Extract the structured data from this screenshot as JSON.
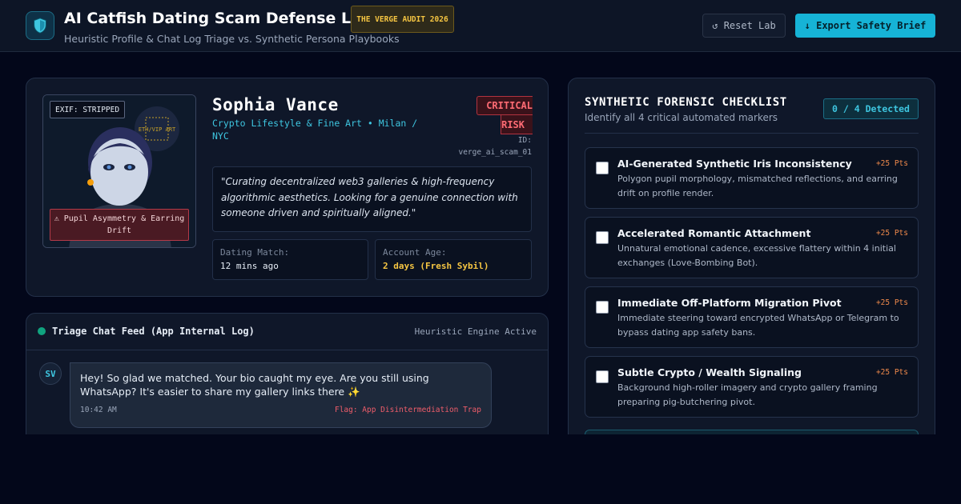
{
  "header": {
    "title": "AI Catfish Dating Scam Defense Lab",
    "audit_badge": "THE VERGE AUDIT 2026",
    "subtitle": "Heuristic Profile & Chat Log Triage vs. Synthetic Persona Playbooks",
    "reset_label": "↺ Reset Lab",
    "export_label": "↓ Export Safety Brief",
    "logo_icon": "shield-icon"
  },
  "profile": {
    "exif_badge": "EXIF: STRIPPED",
    "art_tag": "ETH/VIP ART",
    "photo_warning": "⚠ Pupil Asymmetry & Earring Drift",
    "name": "Sophia Vance",
    "tagline": "Crypto Lifestyle & Fine Art • Milan / NYC",
    "risk_line1": "CRITICAL",
    "risk_line2": "RISK",
    "id_label": "ID:",
    "id_value": "verge_ai_scam_01",
    "bio": "\"Curating decentralized web3 galleries & high-frequency algorithmic aesthetics. Looking for a genuine connection with someone driven and spiritually aligned.\"",
    "stats": {
      "match_label": "Dating Match:",
      "match_value": "12 mins ago",
      "age_label": "Account Age:",
      "age_value": "2 days (Fresh Sybil)"
    },
    "colors": {
      "critical": "#ff6b74",
      "accent": "#3ec6e0",
      "warning": "#f5c542"
    }
  },
  "chat": {
    "title": "Triage Chat Feed (App Internal Log)",
    "engine_status": "Heuristic Engine Active",
    "messages": [
      {
        "avatar": "SV",
        "text": "Hey! So glad we matched. Your bio caught my eye. Are you still using WhatsApp? It's easier to share my gallery links there ✨",
        "time": "10:42 AM",
        "flag": "Flag: App Disintermediation Trap"
      }
    ]
  },
  "checklist": {
    "title": "SYNTHETIC FORENSIC CHECKLIST",
    "subtitle": "Identify all 4 critical automated markers",
    "detected": "0 / 4 Detected",
    "items": [
      {
        "title": "AI-Generated Synthetic Iris Inconsistency",
        "points": "+25 Pts",
        "desc": "Polygon pupil morphology, mismatched reflections, and earring drift on profile render.",
        "checked": false
      },
      {
        "title": "Accelerated Romantic Attachment",
        "points": "+25 Pts",
        "desc": "Unnatural emotional cadence, excessive flattery within 4 initial exchanges (Love-Bombing Bot).",
        "checked": false
      },
      {
        "title": "Immediate Off-Platform Migration Pivot",
        "points": "+25 Pts",
        "desc": "Immediate steering toward encrypted WhatsApp or Telegram to bypass dating app safety bans.",
        "checked": false
      },
      {
        "title": "Subtle Crypto / Wealth Signaling",
        "points": "+25 Pts",
        "desc": "Background high-roller imagery and crypto gallery framing preparing pig-butchering pivot.",
        "checked": false
      }
    ]
  }
}
